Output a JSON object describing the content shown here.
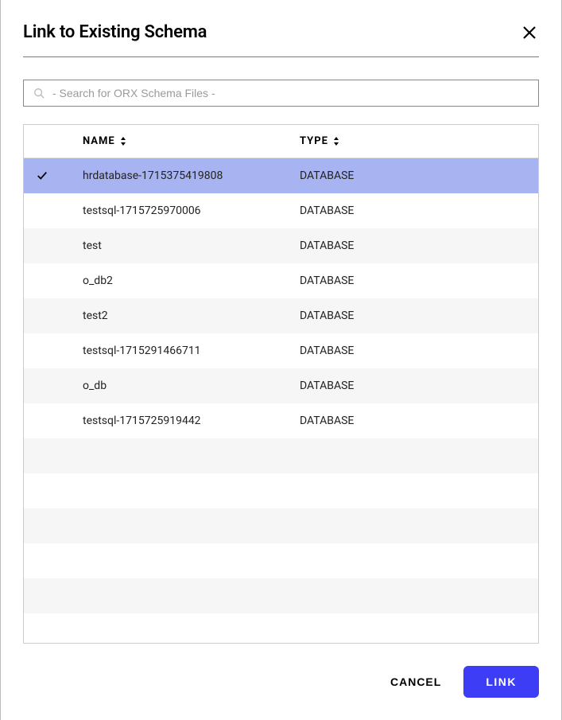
{
  "dialog": {
    "title": "Link to Existing Schema"
  },
  "search": {
    "placeholder": "- Search for ORX Schema Files -"
  },
  "table": {
    "headers": {
      "name": "NAME",
      "type": "TYPE"
    },
    "rows": [
      {
        "name": "hrdatabase-1715375419808",
        "type": "DATABASE",
        "selected": true
      },
      {
        "name": "testsql-1715725970006",
        "type": "DATABASE",
        "selected": false
      },
      {
        "name": "test",
        "type": "DATABASE",
        "selected": false
      },
      {
        "name": "o_db2",
        "type": "DATABASE",
        "selected": false
      },
      {
        "name": "test2",
        "type": "DATABASE",
        "selected": false
      },
      {
        "name": "testsql-1715291466711",
        "type": "DATABASE",
        "selected": false
      },
      {
        "name": "o_db",
        "type": "DATABASE",
        "selected": false
      },
      {
        "name": "testsql-1715725919442",
        "type": "DATABASE",
        "selected": false
      }
    ],
    "empty_rows": 5
  },
  "footer": {
    "cancel": "CANCEL",
    "link": "LINK"
  }
}
